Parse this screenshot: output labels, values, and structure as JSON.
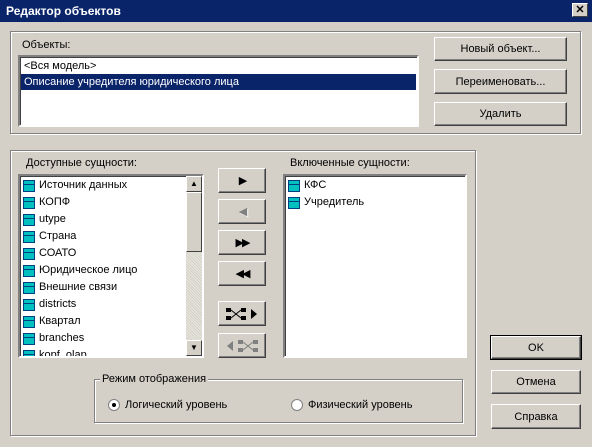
{
  "window": {
    "title": "Редактор объектов",
    "close_glyph": "✕"
  },
  "objects": {
    "label": "Объекты:",
    "items": [
      "<Вся модель>",
      "Описание учредителя юридического лица"
    ],
    "selected_index": 1,
    "buttons": {
      "new": "Новый объект...",
      "rename": "Переименовать...",
      "delete": "Удалить"
    }
  },
  "available": {
    "label": "Доступные сущности:",
    "items": [
      "Источник данных",
      "КОПФ",
      "utype",
      "Страна",
      "СОАТО",
      "Юридическое лицо",
      "Внешние связи",
      "districts",
      "Квартал",
      "branches",
      "kopf_olap"
    ]
  },
  "included": {
    "label": "Включенные сущности:",
    "items": [
      "КФС",
      "Учредитель"
    ]
  },
  "transfer": {
    "add_one": "▶",
    "remove_one": "◀",
    "add_all": "▶▶",
    "remove_all": "◀◀"
  },
  "display_mode": {
    "label": "Режим отображения",
    "options": [
      "Логический уровень",
      "Физический уровень"
    ],
    "selected_index": 0
  },
  "dialog_buttons": {
    "ok": "OK",
    "cancel": "Отмена",
    "help": "Справка"
  }
}
